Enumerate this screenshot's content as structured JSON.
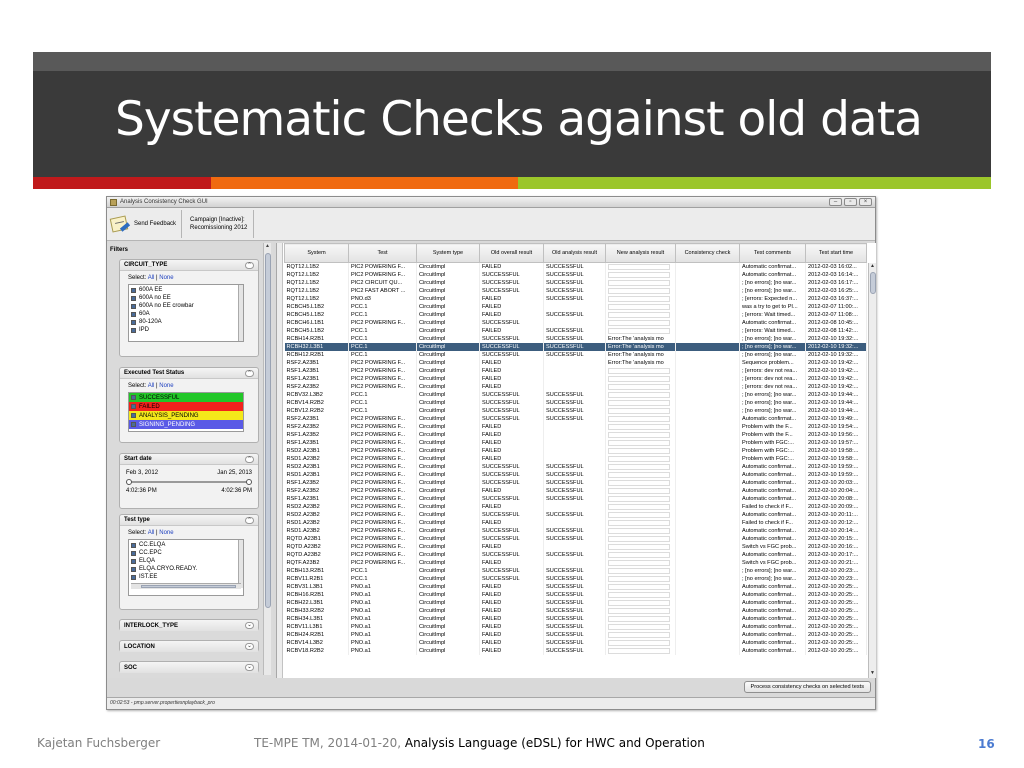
{
  "slide": {
    "title": "Systematic Checks against old data",
    "accent_colors": [
      "#c0191b",
      "#f06a10",
      "#9bc62a"
    ],
    "footer_author": "Kajetan Fuchsberger",
    "footer_event": "TE-MPE TM, 2014-01-20, ",
    "footer_topic": "Analysis Language (eDSL) for HWC and Operation",
    "page_number": "16"
  },
  "window": {
    "title": "Analysis Consistency Check GUI",
    "controls": [
      "minimize",
      "maximize",
      "close"
    ]
  },
  "toolbar": {
    "feedback_label": "Send Feedback",
    "campaign_line1": "Campaign [Inactive]:",
    "campaign_line2": "Recomissioning 2012"
  },
  "filters": {
    "header": "Filters",
    "select_label": "Select:",
    "all_label": "All",
    "separator": "|",
    "none_label": "None",
    "circuit_type": {
      "title": "CIRCUIT_TYPE",
      "items": [
        "600A EE",
        "600A no EE",
        "600A no EE crowbar",
        "60A",
        "80-120A",
        "IPD"
      ]
    },
    "executed_status": {
      "title": "Executed Test Status",
      "items": [
        {
          "label": "SUCCESSFUL",
          "color": "#22c728"
        },
        {
          "label": "FAILED",
          "color": "#f2221d"
        },
        {
          "label": "ANALYSIS_PENDING",
          "color": "#f4e81a"
        },
        {
          "label": "SIGNING_PENDING",
          "color": "#5a5ae6"
        }
      ]
    },
    "start_date": {
      "title": "Start date",
      "from_date": "Feb 3, 2012",
      "to_date": "Jan 25, 2013",
      "from_time": "4:02:36 PM",
      "to_time": "4:02:36 PM"
    },
    "test_type": {
      "title": "Test type",
      "items": [
        "CC.ELQA",
        "CC.EPC",
        "ELQA",
        "ELQA.CRYO.READY.",
        "IST.EE"
      ]
    },
    "interlock_type": {
      "title": "INTERLOCK_TYPE"
    },
    "location": {
      "title": "LOCATION"
    },
    "soc": {
      "title": "SOC"
    }
  },
  "table": {
    "columns": [
      "System",
      "Test",
      "System type",
      "Old overall result",
      "Old analysis result",
      "New analysis result",
      "Consistency check",
      "Test comments",
      "Test start time"
    ],
    "rows": [
      [
        "RQT12.L1B2",
        "PIC2 POWERING F...",
        "CircuitImpl",
        "FAILED",
        "SUCCESSFUL",
        "",
        "",
        "Automatic confirmat...",
        "2012-02-03 16:02..."
      ],
      [
        "RQT12.L1B2",
        "PIC2 POWERING F...",
        "CircuitImpl",
        "SUCCESSFUL",
        "SUCCESSFUL",
        "",
        "",
        "Automatic confirmat...",
        "2012-02-03 16:14:..."
      ],
      [
        "RQT12.L1B2",
        "PIC2 CIRCUIT QU...",
        "CircuitImpl",
        "SUCCESSFUL",
        "SUCCESSFUL",
        "",
        "",
        "; [no errors]; [no war...",
        "2012-02-03 16:17:..."
      ],
      [
        "RQT12.L1B2",
        "PIC2 FAST ABORT ...",
        "CircuitImpl",
        "SUCCESSFUL",
        "SUCCESSFUL",
        "",
        "",
        "; [no errors]; [no war...",
        "2012-02-03 16:25:..."
      ],
      [
        "RQT12.L1B2",
        "PNO.d3",
        "CircuitImpl",
        "FAILED",
        "SUCCESSFUL",
        "",
        "",
        "; [errors: Expected n...",
        "2012-02-03 16:37:..."
      ],
      [
        "RCBCH5.L1B2",
        "PCC.1",
        "CircuitImpl",
        "FAILED",
        "",
        "",
        "",
        "was a try to get to PI...",
        "2012-02-07 11:00:..."
      ],
      [
        "RCBCH5.L1B2",
        "PCC.1",
        "CircuitImpl",
        "FAILED",
        "SUCCESSFUL",
        "",
        "",
        "; [errors: Wait timed...",
        "2012-02-07 11:08:..."
      ],
      [
        "RCBCH6.L1B1",
        "PIC2 POWERING F...",
        "CircuitImpl",
        "SUCCESSFUL",
        "",
        "",
        "",
        "Automatic confirmat...",
        "2012-02-08 10:45:..."
      ],
      [
        "RCBCH5.L1B2",
        "PCC.1",
        "CircuitImpl",
        "FAILED",
        "SUCCESSFUL",
        "",
        "",
        "; [errors: Wait timed...",
        "2012-02-08 11:42:..."
      ],
      [
        "RCBH14.R2B1",
        "PCC.1",
        "CircuitImpl",
        "SUCCESSFUL",
        "SUCCESSFUL",
        "Error:The 'analysis mo",
        "",
        "; [no errors]; [no war...",
        "2012-02-10 19:32:..."
      ],
      [
        "RCBH32.L3B1",
        "PCC.1",
        "CircuitImpl",
        "SUCCESSFUL",
        "SUCCESSFUL",
        "Error:The 'analysis mo",
        "",
        "; [no errors]; [no war...",
        "2012-02-10 19:32:..."
      ],
      [
        "RCBH12.R2B1",
        "PCC.1",
        "CircuitImpl",
        "SUCCESSFUL",
        "SUCCESSFUL",
        "Error:The 'analysis mo",
        "",
        "; [no errors]; [no war...",
        "2012-02-10 19:32:..."
      ],
      [
        "RSF2.A23B1",
        "PIC2 POWERING F...",
        "CircuitImpl",
        "FAILED",
        "",
        "Error:The 'analysis mo",
        "",
        "Sequence problem...",
        "2012-02-10 19:42:..."
      ],
      [
        "RSF1.A23B1",
        "PIC2 POWERING F...",
        "CircuitImpl",
        "FAILED",
        "",
        "",
        "",
        "; [errors: dev not rea...",
        "2012-02-10 19:42:..."
      ],
      [
        "RSF1.A23B1",
        "PIC2 POWERING F...",
        "CircuitImpl",
        "FAILED",
        "",
        "",
        "",
        "; [errors: dev not rea...",
        "2012-02-10 19:42:..."
      ],
      [
        "RSF2.A23B2",
        "PIC2 POWERING F...",
        "CircuitImpl",
        "FAILED",
        "",
        "",
        "",
        "; [errors: dev not rea...",
        "2012-02-10 19:42:..."
      ],
      [
        "RCBV32.L3B2",
        "PCC.1",
        "CircuitImpl",
        "SUCCESSFUL",
        "SUCCESSFUL",
        "",
        "",
        "; [no errors]; [no war...",
        "2012-02-10 19:44:..."
      ],
      [
        "RCBV14.R2B2",
        "PCC.1",
        "CircuitImpl",
        "SUCCESSFUL",
        "SUCCESSFUL",
        "",
        "",
        "; [no errors]; [no war...",
        "2012-02-10 19:44:..."
      ],
      [
        "RCBV12.R2B2",
        "PCC.1",
        "CircuitImpl",
        "SUCCESSFUL",
        "SUCCESSFUL",
        "",
        "",
        "; [no errors]; [no war...",
        "2012-02-10 19:44:..."
      ],
      [
        "RSF2.A23B1",
        "PIC2 POWERING F...",
        "CircuitImpl",
        "SUCCESSFUL",
        "SUCCESSFUL",
        "",
        "",
        "Automatic confirmat...",
        "2012-02-10 19:49:..."
      ],
      [
        "RSF2.A23B2",
        "PIC2 POWERING F...",
        "CircuitImpl",
        "FAILED",
        "",
        "",
        "",
        "Problem with the F...",
        "2012-02-10 19:54:..."
      ],
      [
        "RSF1.A23B2",
        "PIC2 POWERING F...",
        "CircuitImpl",
        "FAILED",
        "",
        "",
        "",
        "Problem with the F...",
        "2012-02-10 19:56:..."
      ],
      [
        "RSF1.A23B1",
        "PIC2 POWERING F...",
        "CircuitImpl",
        "FAILED",
        "",
        "",
        "",
        "Problem with FGC:...",
        "2012-02-10 19:57:..."
      ],
      [
        "RSD2.A23B1",
        "PIC2 POWERING F...",
        "CircuitImpl",
        "FAILED",
        "",
        "",
        "",
        "Problem with FGC:...",
        "2012-02-10 19:58:..."
      ],
      [
        "RSD1.A23B2",
        "PIC2 POWERING F...",
        "CircuitImpl",
        "FAILED",
        "",
        "",
        "",
        "Problem with FGC:...",
        "2012-02-10 19:58:..."
      ],
      [
        "RSD2.A23B1",
        "PIC2 POWERING F...",
        "CircuitImpl",
        "SUCCESSFUL",
        "SUCCESSFUL",
        "",
        "",
        "Automatic confirmat...",
        "2012-02-10 19:59:..."
      ],
      [
        "RSD1.A23B1",
        "PIC2 POWERING F...",
        "CircuitImpl",
        "SUCCESSFUL",
        "SUCCESSFUL",
        "",
        "",
        "Automatic confirmat...",
        "2012-02-10 19:59:..."
      ],
      [
        "RSF1.A23B2",
        "PIC2 POWERING F...",
        "CircuitImpl",
        "SUCCESSFUL",
        "SUCCESSFUL",
        "",
        "",
        "Automatic confirmat...",
        "2012-02-10 20:03:..."
      ],
      [
        "RSF2.A23B2",
        "PIC2 POWERING F...",
        "CircuitImpl",
        "FAILED",
        "SUCCESSFUL",
        "",
        "",
        "Automatic confirmat...",
        "2012-02-10 20:04:..."
      ],
      [
        "RSF1.A23B1",
        "PIC2 POWERING F...",
        "CircuitImpl",
        "SUCCESSFUL",
        "SUCCESSFUL",
        "",
        "",
        "Automatic confirmat...",
        "2012-02-10 20:08:..."
      ],
      [
        "RSD2.A23B2",
        "PIC2 POWERING F...",
        "CircuitImpl",
        "FAILED",
        "",
        "",
        "",
        "Failed to check if F...",
        "2012-02-10 20:09:..."
      ],
      [
        "RSD2.A23B2",
        "PIC2 POWERING F...",
        "CircuitImpl",
        "SUCCESSFUL",
        "SUCCESSFUL",
        "",
        "",
        "Automatic confirmat...",
        "2012-02-10 20:11:..."
      ],
      [
        "RSD1.A23B2",
        "PIC2 POWERING F...",
        "CircuitImpl",
        "FAILED",
        "",
        "",
        "",
        "Failed to check if F...",
        "2012-02-10 20:12:..."
      ],
      [
        "RSD1.A23B2",
        "PIC2 POWERING F...",
        "CircuitImpl",
        "SUCCESSFUL",
        "SUCCESSFUL",
        "",
        "",
        "Automatic confirmat...",
        "2012-02-10 20:14:..."
      ],
      [
        "RQTD.A23B1",
        "PIC2 POWERING F...",
        "CircuitImpl",
        "SUCCESSFUL",
        "SUCCESSFUL",
        "",
        "",
        "Automatic confirmat...",
        "2012-02-10 20:15:..."
      ],
      [
        "RQTD.A23B2",
        "PIC2 POWERING F...",
        "CircuitImpl",
        "FAILED",
        "",
        "",
        "",
        "Switch vs FGC prob...",
        "2012-02-10 20:16:..."
      ],
      [
        "RQTD.A23B2",
        "PIC2 POWERING F...",
        "CircuitImpl",
        "SUCCESSFUL",
        "SUCCESSFUL",
        "",
        "",
        "Automatic confirmat...",
        "2012-02-10 20:17:..."
      ],
      [
        "RQTF.A23B2",
        "PIC2 POWERING F...",
        "CircuitImpl",
        "FAILED",
        "",
        "",
        "",
        "Switch vs FGC prob...",
        "2012-02-10 20:21:..."
      ],
      [
        "RCBH13.R2B1",
        "PCC.1",
        "CircuitImpl",
        "SUCCESSFUL",
        "SUCCESSFUL",
        "",
        "",
        "; [no errors]; [no war...",
        "2012-02-10 20:23:..."
      ],
      [
        "RCBV11.R2B1",
        "PCC.1",
        "CircuitImpl",
        "SUCCESSFUL",
        "SUCCESSFUL",
        "",
        "",
        "; [no errors]; [no war...",
        "2012-02-10 20:23:..."
      ],
      [
        "RCBV31.L3B1",
        "PNO.a1",
        "CircuitImpl",
        "FAILED",
        "SUCCESSFUL",
        "",
        "",
        "Automatic confirmat...",
        "2012-02-10 20:25:..."
      ],
      [
        "RCBH16.R2B1",
        "PNO.a1",
        "CircuitImpl",
        "FAILED",
        "SUCCESSFUL",
        "",
        "",
        "Automatic confirmat...",
        "2012-02-10 20:25:..."
      ],
      [
        "RCBH22.L3B1",
        "PNO.a1",
        "CircuitImpl",
        "FAILED",
        "SUCCESSFUL",
        "",
        "",
        "Automatic confirmat...",
        "2012-02-10 20:25:..."
      ],
      [
        "RCBH33.R2B2",
        "PNO.a1",
        "CircuitImpl",
        "FAILED",
        "SUCCESSFUL",
        "",
        "",
        "Automatic confirmat...",
        "2012-02-10 20:25:..."
      ],
      [
        "RCBH34.L3B1",
        "PNO.a1",
        "CircuitImpl",
        "FAILED",
        "SUCCESSFUL",
        "",
        "",
        "Automatic confirmat...",
        "2012-02-10 20:25:..."
      ],
      [
        "RCBV11.L3B1",
        "PNO.a1",
        "CircuitImpl",
        "FAILED",
        "SUCCESSFUL",
        "",
        "",
        "Automatic confirmat...",
        "2012-02-10 20:25:..."
      ],
      [
        "RCBH24.R2B1",
        "PNO.a1",
        "CircuitImpl",
        "FAILED",
        "SUCCESSFUL",
        "",
        "",
        "Automatic confirmat...",
        "2012-02-10 20:25:..."
      ],
      [
        "RCBV14.L3B2",
        "PNO.a1",
        "CircuitImpl",
        "FAILED",
        "SUCCESSFUL",
        "",
        "",
        "Automatic confirmat...",
        "2012-02-10 20:25:..."
      ],
      [
        "RCBV18.R2B2",
        "PNO.a1",
        "CircuitImpl",
        "FAILED",
        "SUCCESSFUL",
        "",
        "",
        "Automatic confirmat...",
        "2012-02-10 20:25:..."
      ]
    ],
    "selected_row": 10,
    "error_rows": [
      9,
      10,
      11,
      12
    ]
  },
  "process_button": "Process consistency checks on selected tests",
  "statusbar_text": "00:02:53 - pmp.server.propertiesnplayback_pro"
}
